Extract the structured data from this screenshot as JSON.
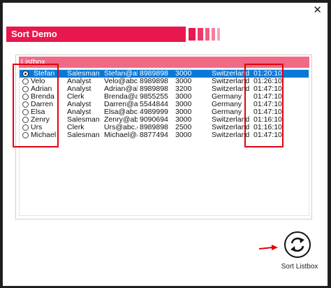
{
  "window": {
    "title": "Sort Demo",
    "close_glyph": "✕"
  },
  "listbox": {
    "label": "Listbox"
  },
  "rows": [
    {
      "name": "Stefan",
      "role": "Salesman",
      "email": "Stefan@ab",
      "phone": "8989898",
      "amount": "3000",
      "country": "Switzerland",
      "time": "01:20:10",
      "selected": true
    },
    {
      "name": "Velo",
      "role": "Analyst",
      "email": "Velo@abc.c",
      "phone": "8989898",
      "amount": "3000",
      "country": "Switzerland",
      "time": "01:26:10",
      "selected": false
    },
    {
      "name": "Adrian",
      "role": "Analyst",
      "email": "Adrian@ab",
      "phone": "8989898",
      "amount": "3200",
      "country": "Switzerland",
      "time": "01:47:10",
      "selected": false
    },
    {
      "name": "Brenda",
      "role": "Clerk",
      "email": "Brenda@ab",
      "phone": "9855255",
      "amount": "3000",
      "country": "Germany",
      "time": "01:47:10",
      "selected": false
    },
    {
      "name": "Darren",
      "role": "Analyst",
      "email": "Darren@ab",
      "phone": "5544844",
      "amount": "3000",
      "country": "Germany",
      "time": "01:47:10",
      "selected": false
    },
    {
      "name": "Elsa",
      "role": "Analyst",
      "email": "Elsa@abc.c",
      "phone": "4989999",
      "amount": "3000",
      "country": "Germany",
      "time": "01:47:10",
      "selected": false
    },
    {
      "name": "Zenry",
      "role": "Salesman",
      "email": "Zenry@abc",
      "phone": "9090694",
      "amount": "3000",
      "country": "Switzerland",
      "time": "01:16:10",
      "selected": false
    },
    {
      "name": "Urs",
      "role": "Clerk",
      "email": "Urs@abc.c",
      "phone": "8989898",
      "amount": "2500",
      "country": "Switzerland",
      "time": "01:16:10",
      "selected": false
    },
    {
      "name": "Michael",
      "role": "Salesman",
      "email": "Michael@ab",
      "phone": "8877494",
      "amount": "3000",
      "country": "Switzerland",
      "time": "01:47:10",
      "selected": false
    }
  ],
  "sort_button": {
    "label": "Sort Listbox",
    "icon": "refresh-icon"
  },
  "colors": {
    "accent": "#e8184f",
    "header": "#f06a86",
    "selection": "#0a78d7",
    "highlight": "#e3000f"
  }
}
